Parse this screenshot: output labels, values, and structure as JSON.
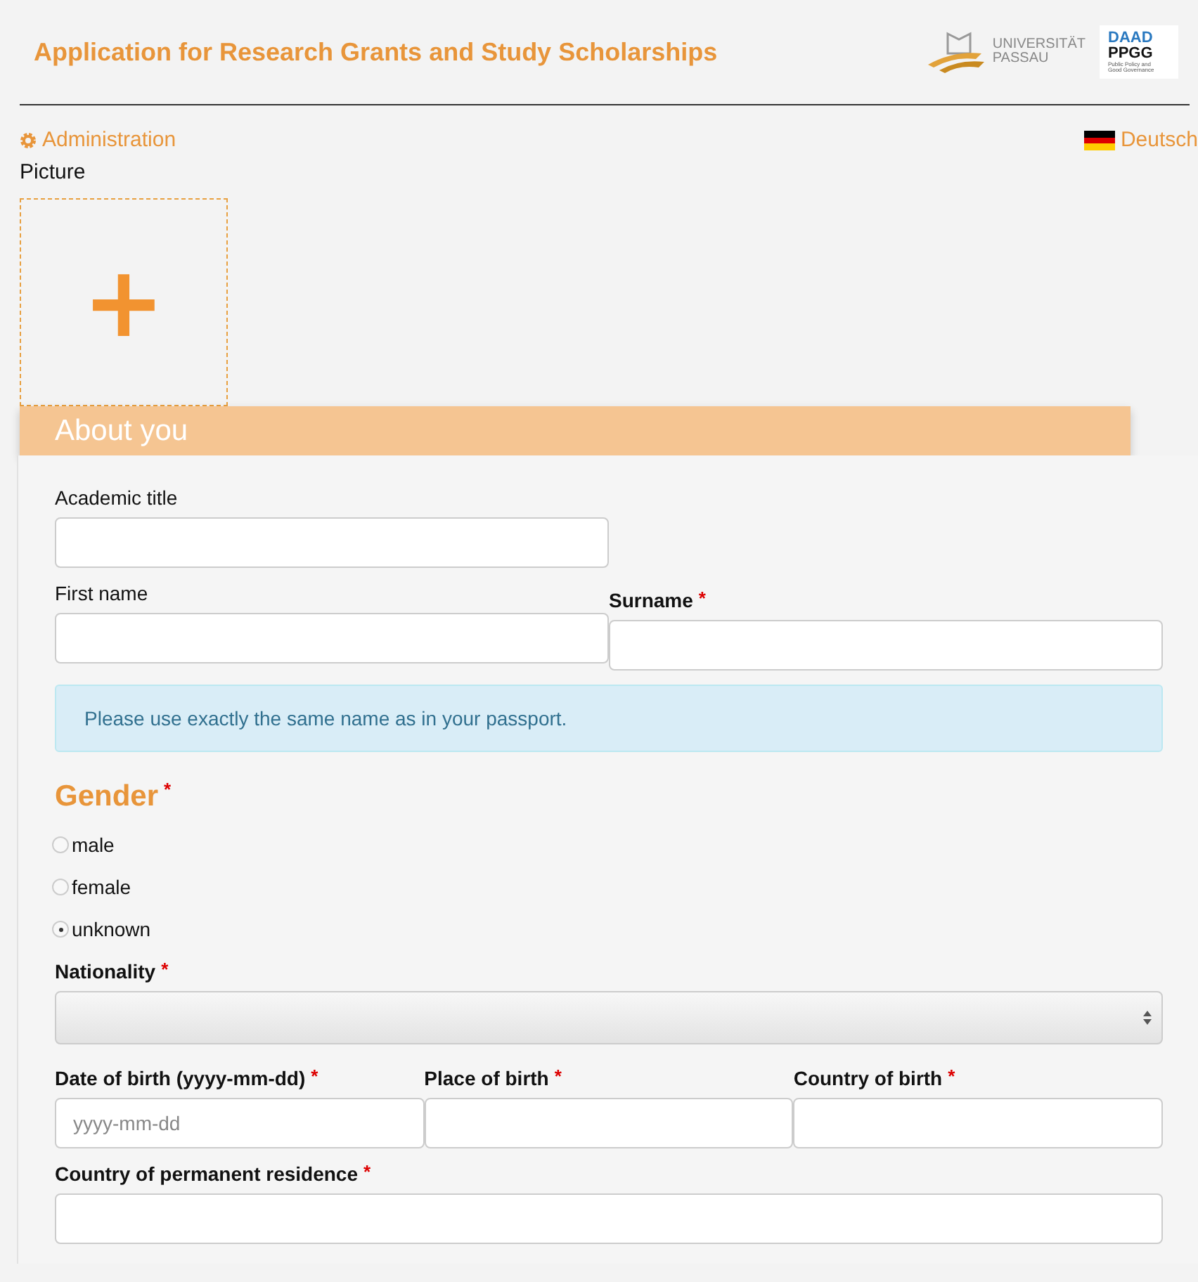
{
  "header": {
    "title": "Application for Research Grants and Study Scholarships",
    "logo_university": {
      "line1": "UNIVERSITÄT",
      "line2": "PASSAU"
    },
    "logo_program": {
      "line1": "DAAD",
      "line2": "PPGG",
      "line3": "Public Policy and",
      "line4": "Good Governance"
    }
  },
  "admin_link": "Administration",
  "language_link": "Deutsch",
  "picture": {
    "label": "Picture",
    "add_symbol": "+"
  },
  "section_title": "About you",
  "required_marker": "*",
  "academic_title": {
    "label": "Academic title"
  },
  "first_name": {
    "label": "First name"
  },
  "surname": {
    "label": "Surname",
    "required": true
  },
  "info": "Please use exactly the same name as in your passport.",
  "gender": {
    "label": "Gender",
    "required": true,
    "options": [
      {
        "label": "male",
        "selected": false
      },
      {
        "label": "female",
        "selected": false
      },
      {
        "label": "unknown",
        "selected": true
      }
    ]
  },
  "nationality": {
    "label": "Nationality",
    "required": true
  },
  "birth_fields": [
    {
      "label": "Date of birth (yyyy-mm-dd)",
      "required": true,
      "placeholder": "yyyy-mm-dd"
    },
    {
      "label": "Place of birth",
      "required": true
    },
    {
      "label": "Country of birth",
      "required": true
    }
  ],
  "residence": {
    "label": "Country of permanent residence",
    "required": true
  }
}
